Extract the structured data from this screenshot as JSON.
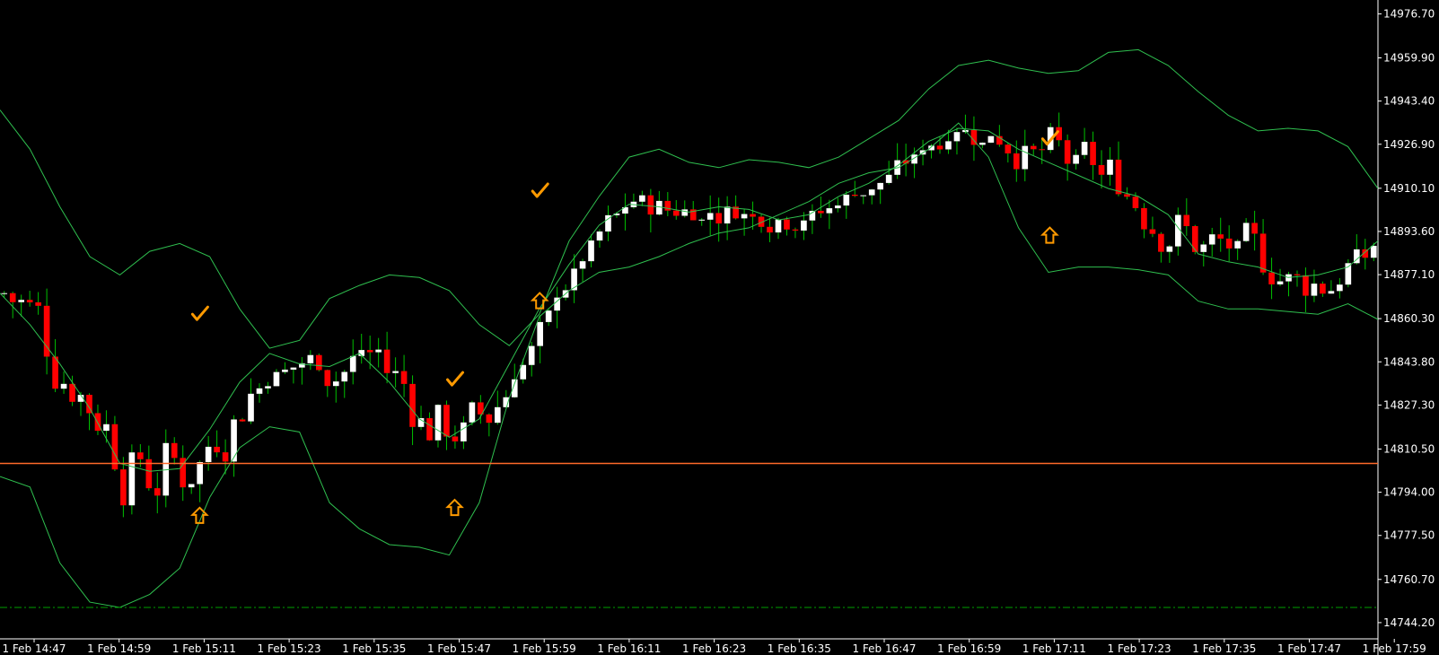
{
  "chart_data": {
    "type": "candlestick",
    "grid": false,
    "background": "#000000",
    "colors": {
      "bull": "#ffffff",
      "bear": "#ff0000",
      "wick": "#00c000",
      "bands": "#2fbf4f",
      "level_line": "#ff6a2a",
      "dashed_line": "#00a000",
      "marker": "#ff9a00",
      "axis": "#ffffff"
    },
    "ylim": [
      14738,
      14982
    ],
    "y_ticks": [
      "14976.70",
      "14959.90",
      "14943.40",
      "14926.90",
      "14910.10",
      "14893.60",
      "14877.10",
      "14860.30",
      "14843.80",
      "14827.30",
      "14810.50",
      "14794.00",
      "14777.50",
      "14760.70",
      "14744.20"
    ],
    "x_ticks": [
      "1 Feb 14:47",
      "1 Feb 14:59",
      "1 Feb 15:11",
      "1 Feb 15:23",
      "1 Feb 15:35",
      "1 Feb 15:47",
      "1 Feb 15:59",
      "1 Feb 16:11",
      "1 Feb 16:23",
      "1 Feb 16:35",
      "1 Feb 16:47",
      "1 Feb 16:59",
      "1 Feb 17:11",
      "1 Feb 17:23",
      "1 Feb 17:35",
      "1 Feb 17:47",
      "1 Feb 17:59"
    ],
    "horizontal_line": 14805,
    "dashed_line": 14750,
    "bands_upper": [
      14940,
      14925,
      14903,
      14884,
      14877,
      14886,
      14889,
      14884,
      14864,
      14849,
      14852,
      14868,
      14873,
      14877,
      14876,
      14871,
      14858,
      14850,
      14862,
      14890,
      14907,
      14922,
      14925,
      14920,
      14918,
      14921,
      14920,
      14918,
      14922,
      14929,
      14936,
      14948,
      14957,
      14959,
      14956,
      14954,
      14955,
      14962,
      14963,
      14957,
      14947,
      14938,
      14932,
      14933,
      14932,
      14926,
      14910
    ],
    "bands_mid": [
      14870,
      14858,
      14843,
      14826,
      14805,
      14802,
      14803,
      14818,
      14836,
      14847,
      14843,
      14842,
      14847,
      14836,
      14822,
      14815,
      14822,
      14843,
      14864,
      14881,
      14896,
      14904,
      14903,
      14901,
      14903,
      14902,
      14898,
      14900,
      14907,
      14912,
      14919,
      14928,
      14933,
      14932,
      14925,
      14920,
      14915,
      14910,
      14907,
      14900,
      14885,
      14882,
      14880,
      14876,
      14877,
      14880,
      14890
    ],
    "bands_lower": [
      14800,
      14796,
      14767,
      14752,
      14750,
      14755,
      14765,
      14792,
      14811,
      14819,
      14817,
      14790,
      14780,
      14774,
      14773,
      14770,
      14790,
      14830,
      14861,
      14871,
      14878,
      14880,
      14884,
      14889,
      14893,
      14895,
      14900,
      14905,
      14912,
      14916,
      14918,
      14925,
      14935,
      14922,
      14895,
      14878,
      14880,
      14880,
      14879,
      14877,
      14867,
      14864,
      14864,
      14863,
      14862,
      14866,
      14860
    ],
    "markers": [
      {
        "type": "arrow",
        "x": "1 Feb 15:11",
        "y": 14785
      },
      {
        "type": "check",
        "x": "1 Feb 15:11",
        "y": 14862
      },
      {
        "type": "arrow",
        "x": "1 Feb 15:47",
        "y": 14788
      },
      {
        "type": "check",
        "x": "1 Feb 15:47",
        "y": 14837
      },
      {
        "type": "arrow",
        "x": "1 Feb 15:59",
        "y": 14867
      },
      {
        "type": "check",
        "x": "1 Feb 15:59",
        "y": 14909
      },
      {
        "type": "arrow",
        "x": "1 Feb 17:11",
        "y": 14892
      },
      {
        "type": "check",
        "x": "1 Feb 17:11",
        "y": 14929
      }
    ]
  }
}
